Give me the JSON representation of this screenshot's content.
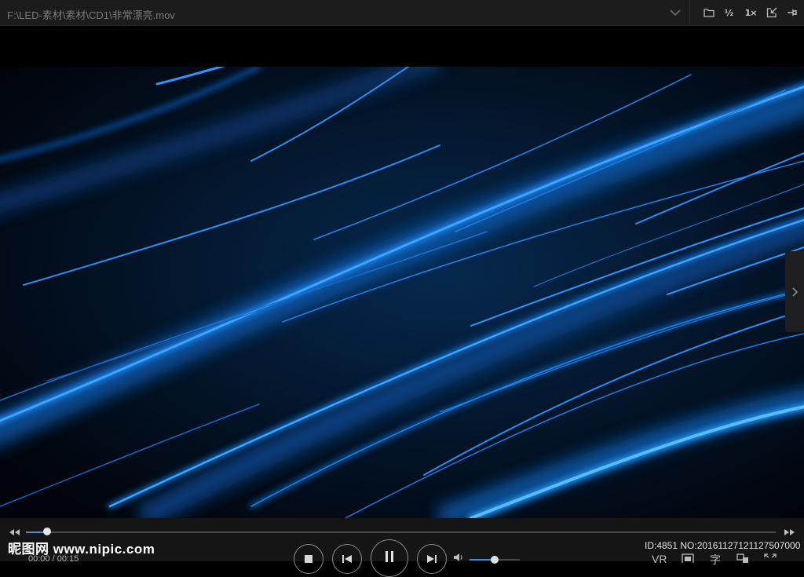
{
  "window": {
    "title": "F:\\LED-素材\\素材\\CD1\\非常漂亮.mov"
  },
  "toolbar": {
    "open_icon": "folder-icon",
    "half_label": "½",
    "speed_label": "1×",
    "export_icon": "export-icon",
    "pin_icon": "pin-icon"
  },
  "player": {
    "current_time": "00:00",
    "separator": " / ",
    "total_time": "00:15",
    "progress": 0.028,
    "volume": 0.5
  },
  "controls": {
    "stop_icon": "stop-icon",
    "prev_icon": "previous-icon",
    "pause_icon": "pause-icon",
    "next_icon": "next-icon",
    "volume_icon": "volume-icon"
  },
  "right_buttons": {
    "vr_label": "VR",
    "subtitle_label": "字"
  },
  "watermark": {
    "logo_text": "昵图网 www.nipic.com",
    "id_text": "ID:4851 NO:20161127121127507000"
  },
  "colors": {
    "accent": "#3f8fd8",
    "titlebar_bg": "#1c1c1c",
    "controls_bg": "#151515",
    "streak_blue": "#1a8cff"
  }
}
